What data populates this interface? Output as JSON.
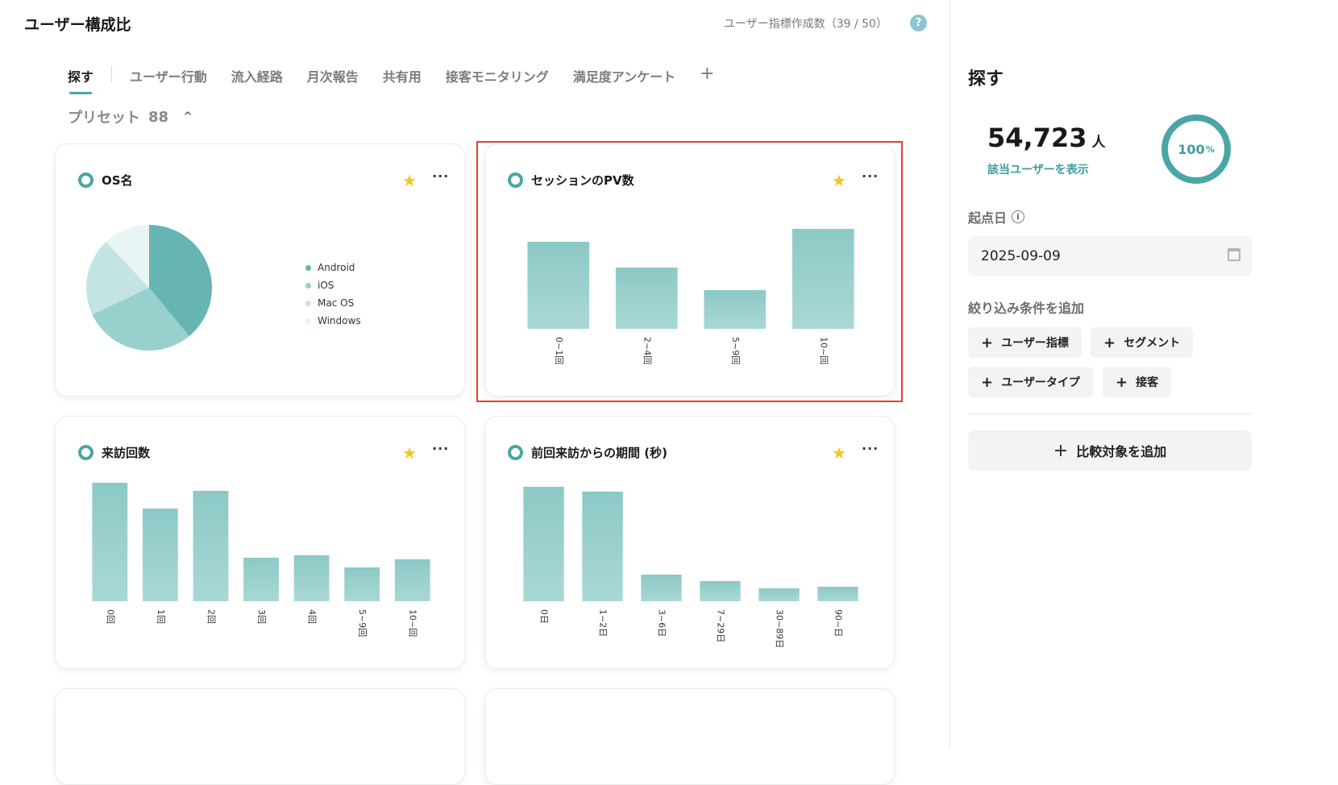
{
  "header": {
    "title": "ユーザー構成比",
    "quota": "ユーザー指標作成数（39 / 50）",
    "help": "?"
  },
  "tabs": [
    {
      "label": "探す",
      "active": true
    },
    {
      "label": "ユーザー行動"
    },
    {
      "label": "流入経路"
    },
    {
      "label": "月次報告"
    },
    {
      "label": "共有用"
    },
    {
      "label": "接客モニタリング"
    },
    {
      "label": "満足度アンケート"
    }
  ],
  "tab_add": "+",
  "preset": {
    "label": "プリセット",
    "count": "88",
    "chevron": "^"
  },
  "cards": {
    "os": {
      "title": "OS名"
    },
    "pv": {
      "title": "セッションのPV数"
    },
    "visits": {
      "title": "来訪回数"
    },
    "period": {
      "title": "前回来訪からの期間 (秒)"
    }
  },
  "colors": {
    "accent": "#4aa6a4",
    "bar_top": "#8cc9c6",
    "bar_bottom": "#a9d8d5",
    "highlight": "#e0402a",
    "star": "#f5c518"
  },
  "chart_data": [
    {
      "id": "os",
      "type": "pie",
      "title": "OS名",
      "categories": [
        "Android",
        "iOS",
        "Mac OS",
        "Windows"
      ],
      "values": [
        39,
        29,
        20,
        12
      ],
      "colors": [
        "#66b5b3",
        "#97d0cd",
        "#c3e4e2",
        "#e9f5f4"
      ]
    },
    {
      "id": "pv",
      "type": "bar",
      "title": "セッションのPV数",
      "categories": [
        "0~1回",
        "2~4回",
        "5~9回",
        "10~回"
      ],
      "values": [
        108,
        76,
        48,
        124
      ],
      "ylim": [
        0,
        124
      ]
    },
    {
      "id": "visits",
      "type": "bar",
      "title": "来訪回数",
      "categories": [
        "0回",
        "1回",
        "2回",
        "3回",
        "4回",
        "5~9回",
        "10~回"
      ],
      "values": [
        147,
        115,
        137,
        54,
        57,
        42,
        52
      ],
      "ylim": [
        0,
        147
      ]
    },
    {
      "id": "period",
      "type": "bar",
      "title": "前回来訪からの期間 (秒)",
      "categories": [
        "0日",
        "1~2日",
        "3~6日",
        "7~29日",
        "30~89日",
        "90~日"
      ],
      "values": [
        142,
        136,
        33,
        25,
        16,
        18
      ],
      "ylim": [
        0,
        142
      ]
    }
  ],
  "panel": {
    "title": "探す",
    "count": "54,723",
    "count_unit": "人",
    "count_link": "該当ユーザーを表示",
    "percent": "100",
    "percent_unit": "%",
    "start_label": "起点日",
    "start_date": "2025-09-09",
    "filter_label": "絞り込み条件を追加",
    "chips": [
      "ユーザー指標",
      "セグメント",
      "ユーザータイプ",
      "接客"
    ],
    "compare": "比較対象を追加"
  }
}
